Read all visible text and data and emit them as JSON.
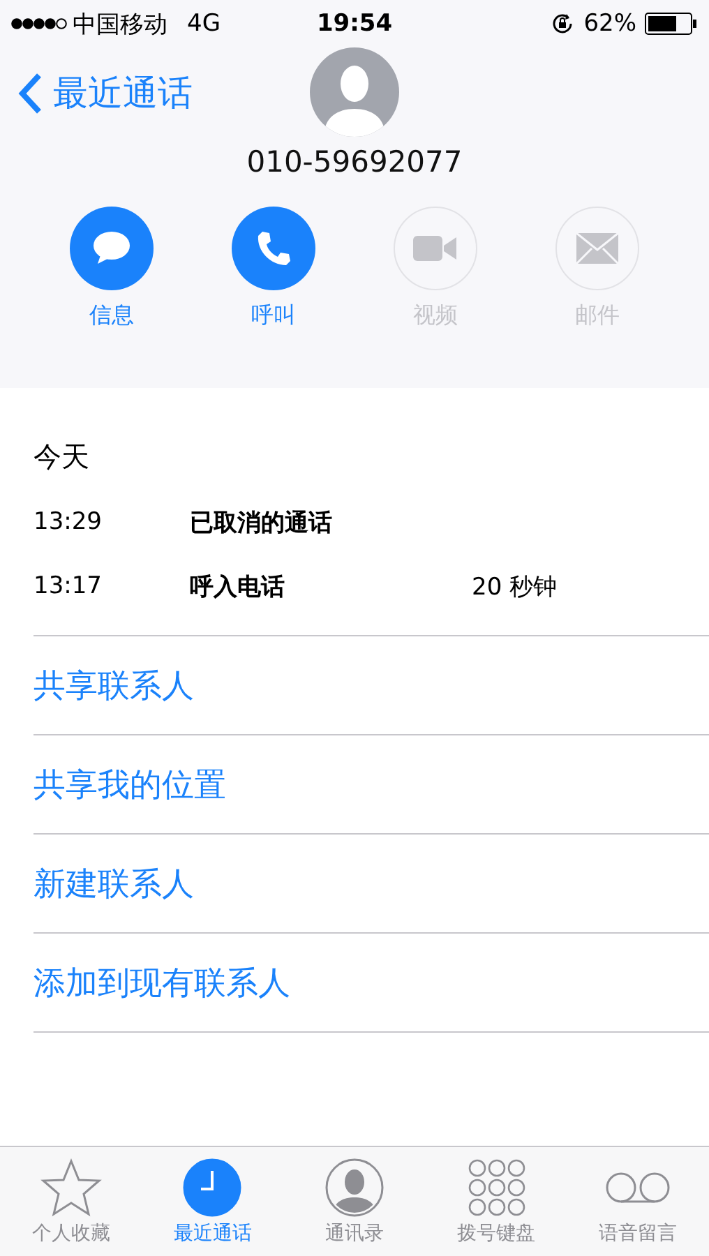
{
  "status_bar": {
    "carrier": "中国移动",
    "network": "4G",
    "time": "19:54",
    "battery": "62%"
  },
  "nav": {
    "back": "最近通话"
  },
  "contact": {
    "number": "010-59692077"
  },
  "actions": [
    {
      "kind": "message",
      "label": "信息",
      "disabled": false
    },
    {
      "kind": "call",
      "label": "呼叫",
      "disabled": false
    },
    {
      "kind": "video",
      "label": "视频",
      "disabled": true
    },
    {
      "kind": "mail",
      "label": "邮件",
      "disabled": true
    }
  ],
  "history": {
    "title": "今天",
    "calls": [
      {
        "time": "13:29",
        "type": "已取消的通话"
      },
      {
        "time": "13:17",
        "type": "呼入电话",
        "duration": "20 秒钟"
      }
    ]
  },
  "links": [
    "共享联系人",
    "共享我的位置",
    "新建联系人",
    "添加到现有联系人"
  ],
  "tabs": [
    {
      "kind": "favorites",
      "label": "个人收藏",
      "selected": false
    },
    {
      "kind": "recents",
      "label": "最近通话",
      "selected": true
    },
    {
      "kind": "contacts",
      "label": "通讯录",
      "selected": false
    },
    {
      "kind": "keypad",
      "label": "拨号键盘",
      "selected": false
    },
    {
      "kind": "voicemail",
      "label": "语音留言",
      "selected": false
    }
  ]
}
